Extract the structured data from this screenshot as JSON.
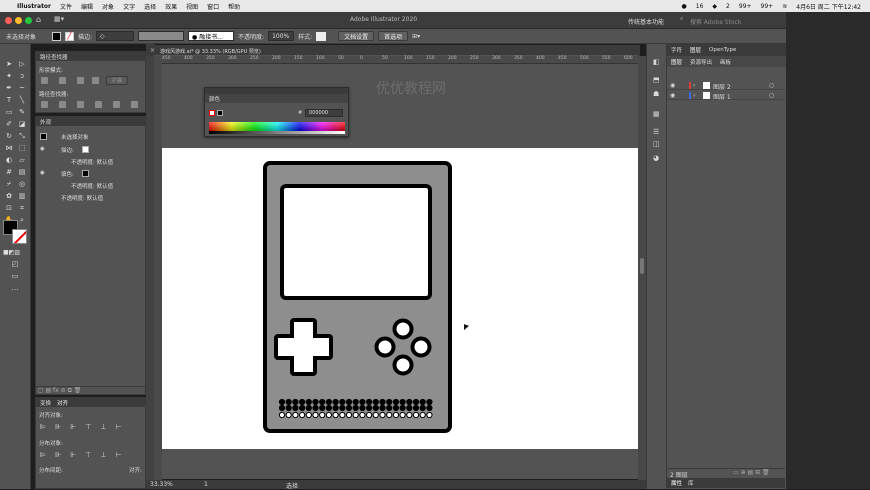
{
  "menubar": {
    "app": "Illustrator",
    "items": [
      "文件",
      "编辑",
      "对象",
      "文字",
      "选择",
      "效果",
      "视图",
      "窗口",
      "帮助"
    ],
    "status_items": [
      "16",
      "2",
      "99+",
      "99+"
    ],
    "datetime": "4月6日 周二 下午12:42"
  },
  "window": {
    "title": "Adobe Illustrator 2020",
    "workspace": "传统基本功能",
    "search_placeholder": "搜索 Adobe Stock"
  },
  "control_bar": {
    "selection": "未选择对象",
    "stroke_label": "描边:",
    "brush": "● 融接书...",
    "opacity_label": "不透明度:",
    "opacity_value": "100%",
    "style_label": "样式:",
    "doc_setup": "文档设置",
    "prefs": "首选项"
  },
  "doc_tab": {
    "label": "游戏风游戏.ai* @ 33.33% (RGB/GPU 预览)"
  },
  "ruler": {
    "labels": [
      "450",
      "400",
      "350",
      "300",
      "250",
      "200",
      "150",
      "100",
      "50",
      "0",
      "50",
      "100",
      "150",
      "200",
      "250",
      "300",
      "350",
      "400",
      "450",
      "500",
      "550",
      "600"
    ]
  },
  "pathfinder": {
    "title": "路径查找器",
    "shape_modes": "形状模式:",
    "expand": "扩展",
    "pathfinders": "路径查找器:"
  },
  "appearance": {
    "title": "外观",
    "none_selected": "未选择对象",
    "stroke": "描边:",
    "opacity1": "不透明度: 默认值",
    "fill": "填色:",
    "opacity2": "不透明度: 默认值",
    "opacity3": "不透明度: 默认值"
  },
  "transform": {
    "tabs": [
      "变换",
      "对齐"
    ],
    "align_objects": "对齐对象:",
    "distribute_objects": "分布对象:",
    "distribute_spacing": "分布间距:",
    "align_to": "对齐:"
  },
  "color_panel": {
    "title": "颜色",
    "hex": "000000"
  },
  "watermark": "优优教程网",
  "layers_panel": {
    "tabs": [
      "字符",
      "图层",
      "OpenType"
    ],
    "subtabs": [
      "图层",
      "资源导出",
      "画板"
    ],
    "layers": [
      {
        "name": "图层 2",
        "color": "#e23c3c"
      },
      {
        "name": "图层 1",
        "color": "#3c6ee2"
      }
    ],
    "count": "2 图层",
    "bottom_tabs": [
      "属性",
      "库"
    ]
  },
  "status": {
    "zoom": "33.33%",
    "page": "1",
    "tool": "选择"
  },
  "colors": {
    "accent": "#2f7bd9",
    "device_fill": "#8f8e8f",
    "screen": "#ffffff",
    "outline": "#000000"
  }
}
